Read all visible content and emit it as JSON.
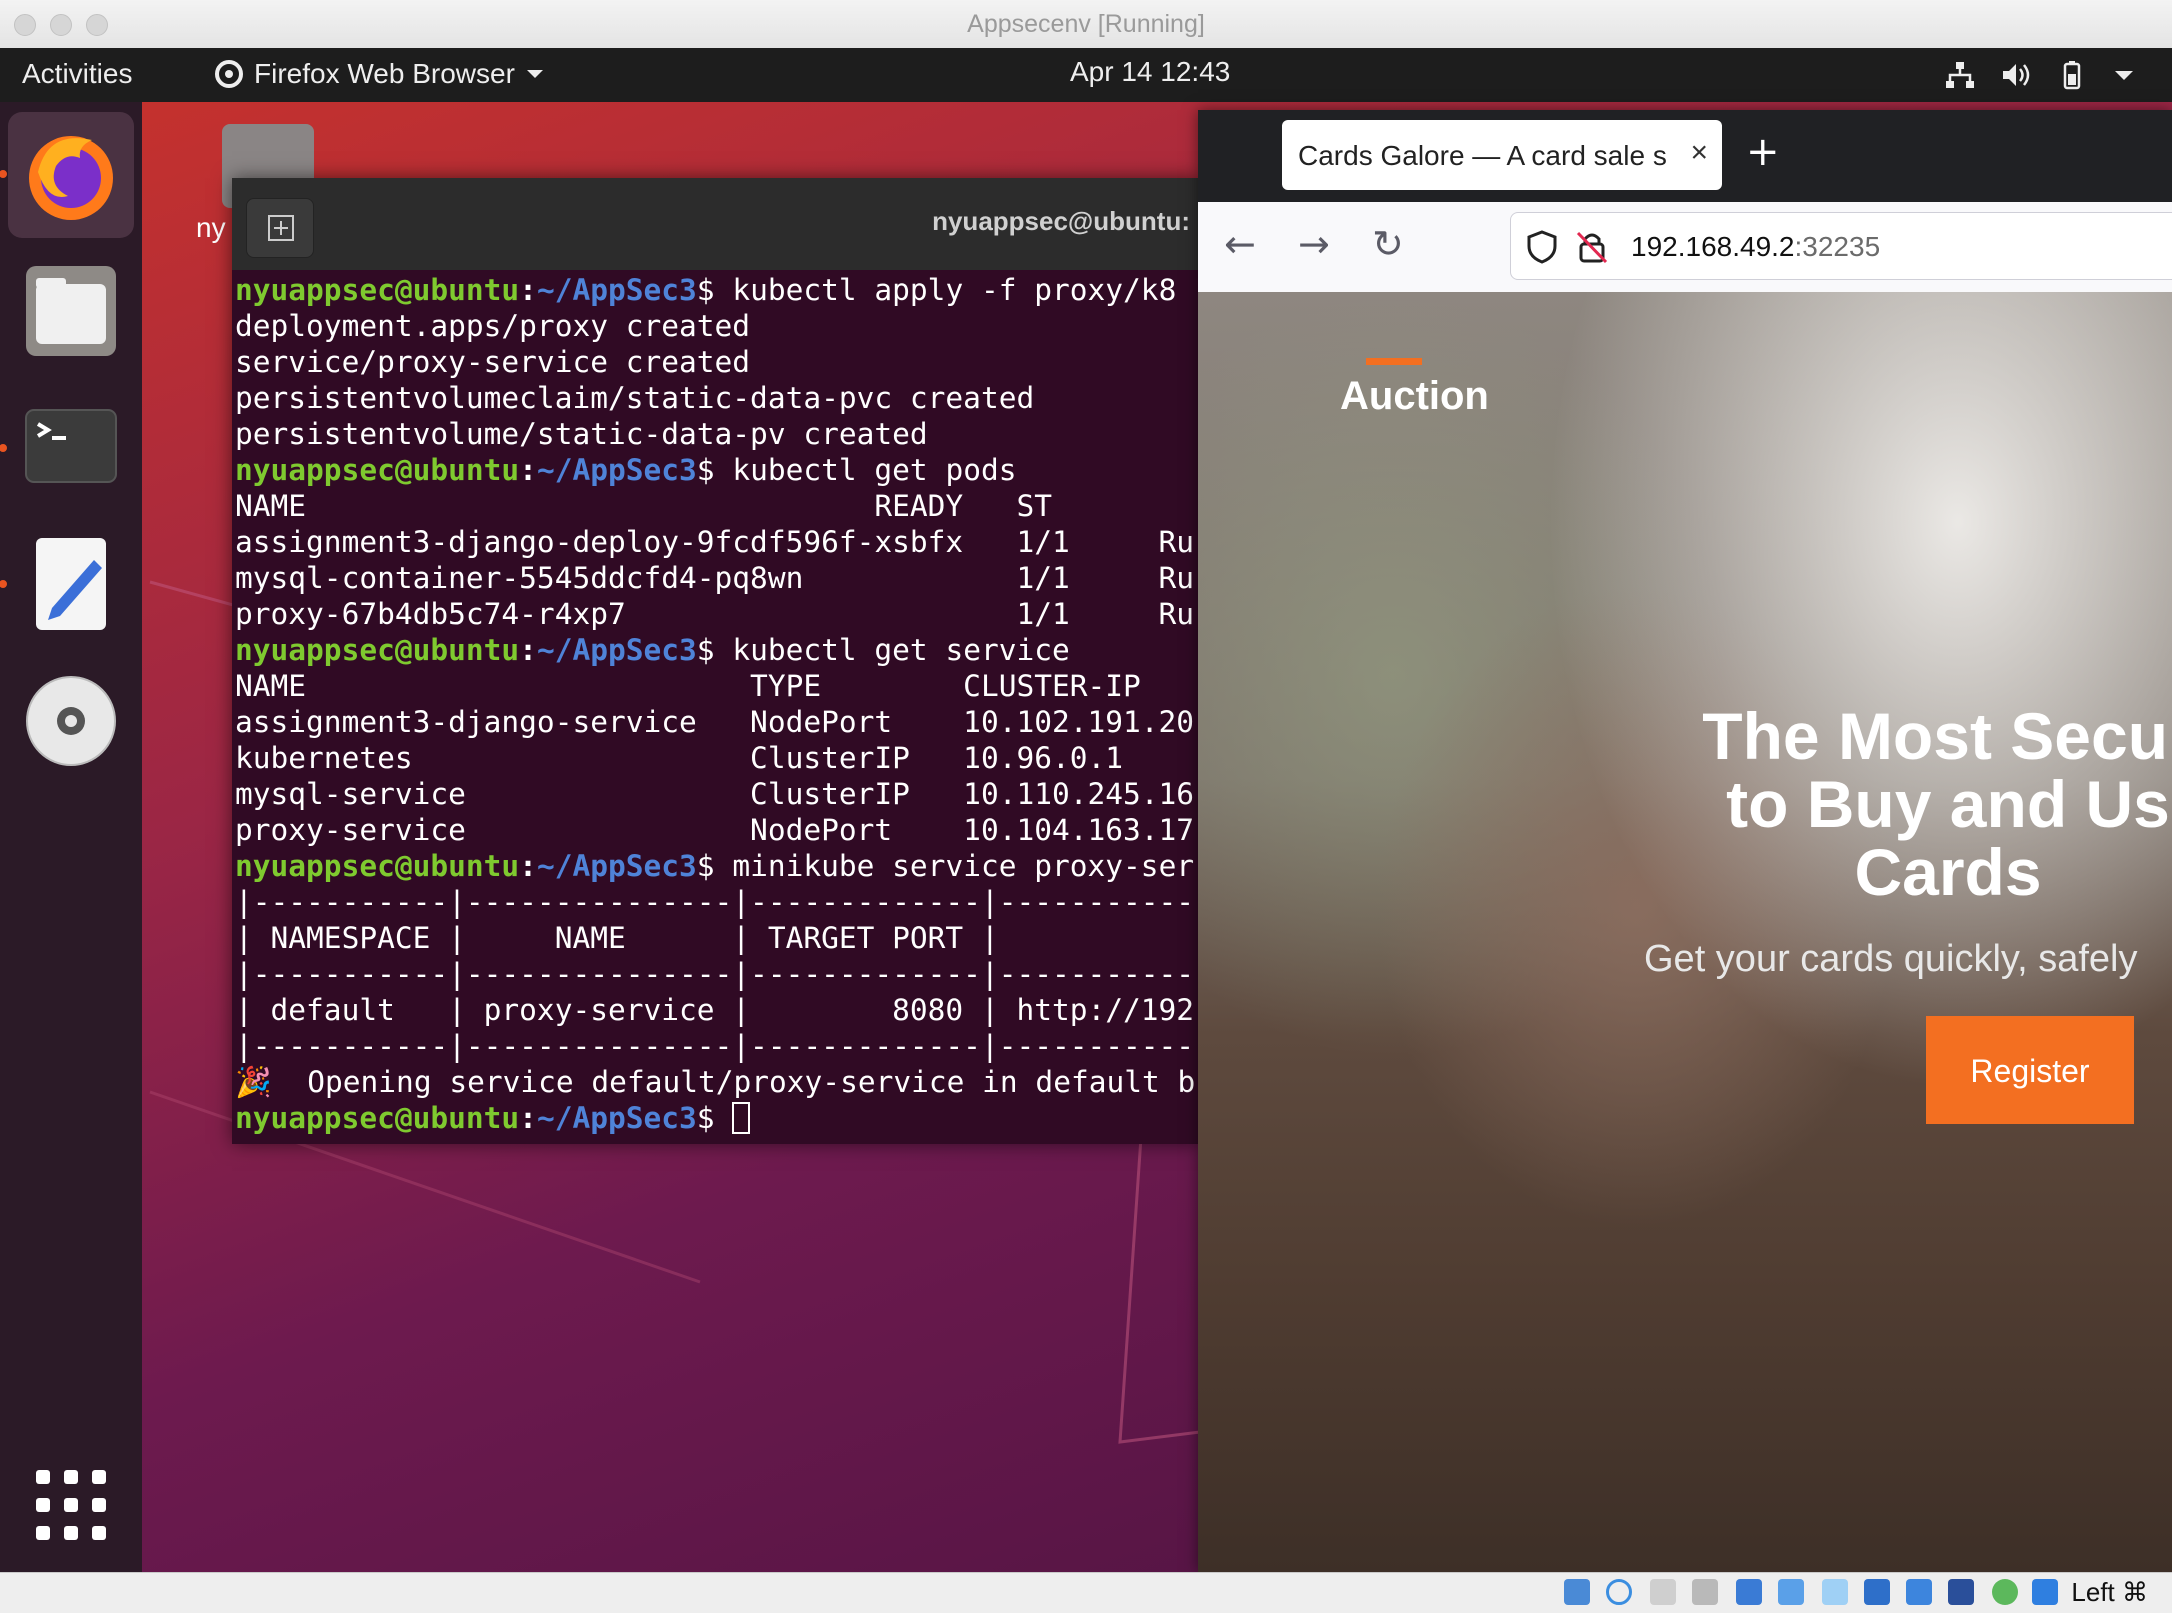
{
  "host": {
    "title": "Appsecenv [Running]",
    "host_key_label": "Left ⌘"
  },
  "topbar": {
    "activities": "Activities",
    "app_name": "Firefox Web Browser",
    "clock": "Apr 14  12:43"
  },
  "desktop": {
    "home_label": "ny"
  },
  "terminal": {
    "title": "nyuappsec@ubuntu:",
    "prompt_user": "nyuappsec@ubuntu",
    "prompt_colon": ":",
    "prompt_path": "~/AppSec3",
    "lines": [
      {
        "prompt": true,
        "text": "$ kubectl apply -f proxy/k8"
      },
      {
        "prompt": false,
        "text": "deployment.apps/proxy created"
      },
      {
        "prompt": false,
        "text": "service/proxy-service created"
      },
      {
        "prompt": false,
        "text": "persistentvolumeclaim/static-data-pvc created"
      },
      {
        "prompt": false,
        "text": "persistentvolume/static-data-pv created"
      },
      {
        "prompt": true,
        "text": "$ kubectl get pods"
      },
      {
        "prompt": false,
        "text": "NAME                                READY   ST"
      },
      {
        "prompt": false,
        "text": "assignment3-django-deploy-9fcdf596f-xsbfx   1/1     Ru"
      },
      {
        "prompt": false,
        "text": "mysql-container-5545ddcfd4-pq8wn            1/1     Ru"
      },
      {
        "prompt": false,
        "text": "proxy-67b4db5c74-r4xp7                      1/1     Ru"
      },
      {
        "prompt": true,
        "text": "$ kubectl get service"
      },
      {
        "prompt": false,
        "text": "NAME                         TYPE        CLUSTER-IP"
      },
      {
        "prompt": false,
        "text": "assignment3-django-service   NodePort    10.102.191.20"
      },
      {
        "prompt": false,
        "text": "kubernetes                   ClusterIP   10.96.0.1"
      },
      {
        "prompt": false,
        "text": "mysql-service                ClusterIP   10.110.245.16"
      },
      {
        "prompt": false,
        "text": "proxy-service                NodePort    10.104.163.17"
      },
      {
        "prompt": true,
        "text": "$ minikube service proxy-ser"
      },
      {
        "prompt": false,
        "text": "|-----------|---------------|-------------|-----------"
      },
      {
        "prompt": false,
        "text": "| NAMESPACE |     NAME      | TARGET PORT |"
      },
      {
        "prompt": false,
        "text": "|-----------|---------------|-------------|-----------"
      },
      {
        "prompt": false,
        "text": "| default   | proxy-service |        8080 | http://192"
      },
      {
        "prompt": false,
        "text": "|-----------|---------------|-------------|-----------"
      },
      {
        "prompt": false,
        "text": "🎉  Opening service default/proxy-service in default b"
      },
      {
        "prompt": true,
        "text": "$ ",
        "cursor": true
      }
    ]
  },
  "browser": {
    "tab_title": "Cards Galore — A card sale s",
    "tab_close": "×",
    "new_tab": "+",
    "url_host": "192.168.49.2",
    "url_port": ":32235",
    "nav": {
      "back": "←",
      "forward": "→",
      "reload": "↻"
    }
  },
  "site": {
    "brand": "Auction",
    "hero_line1": "The Most Secur",
    "hero_line2": "to Buy and Us",
    "hero_line3": "Cards",
    "subtitle": "Get your cards quickly, safely",
    "register_label": "Register",
    "accent_color": "#f36f21"
  }
}
